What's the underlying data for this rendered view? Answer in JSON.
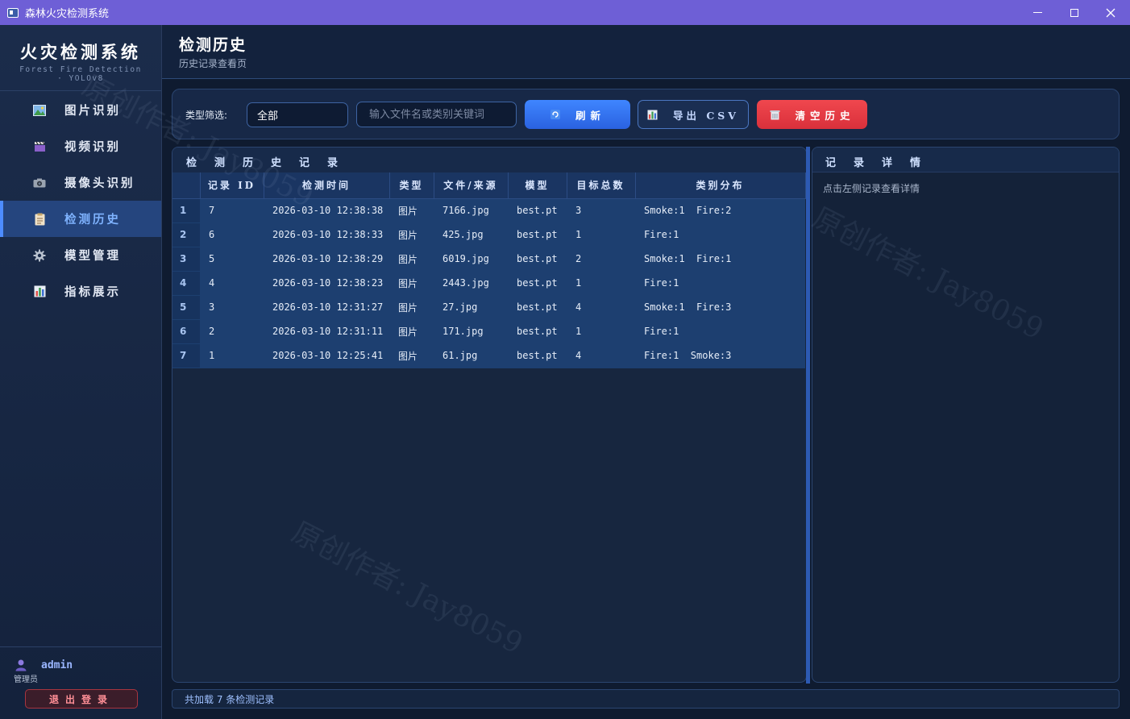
{
  "window": {
    "title": "森林火灾检测系统"
  },
  "sidebar": {
    "brand_title": "火灾检测系统",
    "brand_subtitle": "Forest Fire Detection · YOLOv8",
    "items": [
      {
        "label": "图片识别",
        "icon": "image-icon"
      },
      {
        "label": "视频识别",
        "icon": "clapperboard-icon"
      },
      {
        "label": "摄像头识别",
        "icon": "camera-icon"
      },
      {
        "label": "检测历史",
        "icon": "clipboard-icon",
        "active": true
      },
      {
        "label": "模型管理",
        "icon": "gear-icon"
      },
      {
        "label": "指标展示",
        "icon": "bar-chart-icon"
      }
    ],
    "user": {
      "name": "admin",
      "role": "管理员",
      "icon": "user-icon"
    },
    "logout_label": "退出登录"
  },
  "header": {
    "title": "检测历史",
    "subtitle": "历史记录查看页"
  },
  "toolbar": {
    "filter_label": "类型筛选:",
    "filter_value": "全部",
    "search_placeholder": "输入文件名或类别关键词",
    "refresh_label": "刷新",
    "export_label": "导出 CSV",
    "clear_label": "清空历史"
  },
  "history": {
    "title": "检测历史记录",
    "columns": [
      "记录 ID",
      "检测时间",
      "类型",
      "文件/来源",
      "模型",
      "目标总数",
      "类别分布"
    ],
    "rows": [
      {
        "n": "1",
        "id": "7",
        "time": "2026-03-10 12:38:38",
        "type": "图片",
        "file": "7166.jpg",
        "model": "best.pt",
        "total": "3",
        "dist": "Smoke:1  Fire:2"
      },
      {
        "n": "2",
        "id": "6",
        "time": "2026-03-10 12:38:33",
        "type": "图片",
        "file": "425.jpg",
        "model": "best.pt",
        "total": "1",
        "dist": "Fire:1"
      },
      {
        "n": "3",
        "id": "5",
        "time": "2026-03-10 12:38:29",
        "type": "图片",
        "file": "6019.jpg",
        "model": "best.pt",
        "total": "2",
        "dist": "Smoke:1  Fire:1"
      },
      {
        "n": "4",
        "id": "4",
        "time": "2026-03-10 12:38:23",
        "type": "图片",
        "file": "2443.jpg",
        "model": "best.pt",
        "total": "1",
        "dist": "Fire:1"
      },
      {
        "n": "5",
        "id": "3",
        "time": "2026-03-10 12:31:27",
        "type": "图片",
        "file": "27.jpg",
        "model": "best.pt",
        "total": "4",
        "dist": "Smoke:1  Fire:3"
      },
      {
        "n": "6",
        "id": "2",
        "time": "2026-03-10 12:31:11",
        "type": "图片",
        "file": "171.jpg",
        "model": "best.pt",
        "total": "1",
        "dist": "Fire:1"
      },
      {
        "n": "7",
        "id": "1",
        "time": "2026-03-10 12:25:41",
        "type": "图片",
        "file": "61.jpg",
        "model": "best.pt",
        "total": "4",
        "dist": "Fire:1  Smoke:3"
      }
    ]
  },
  "detail": {
    "title": "记录详情",
    "hint": "点击左侧记录查看详情"
  },
  "status": {
    "text": "共加载 7 条检测记录"
  },
  "watermark": {
    "text": "原创作者: Jay8059"
  }
}
